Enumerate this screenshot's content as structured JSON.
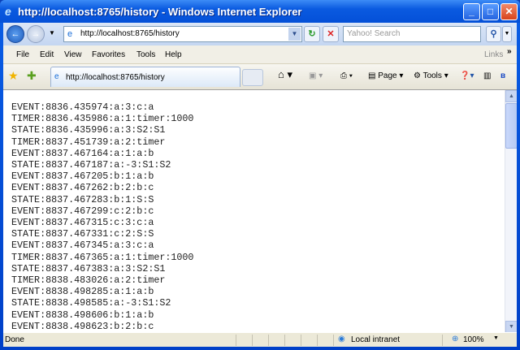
{
  "window": {
    "title": "http://localhost:8765/history - Windows Internet Explorer"
  },
  "addressbar": {
    "url": "http://localhost:8765/history",
    "search_placeholder": "Yahoo! Search"
  },
  "menu": [
    {
      "label": "File"
    },
    {
      "label": "Edit"
    },
    {
      "label": "View"
    },
    {
      "label": "Favorites"
    },
    {
      "label": "Tools"
    },
    {
      "label": "Help"
    }
  ],
  "links_label": "Links",
  "tab": {
    "label": "http://localhost:8765/history"
  },
  "toolbar": {
    "page_label": "Page",
    "tools_label": "Tools"
  },
  "log_lines": [
    "EVENT:8836.435974:a:3:c:a",
    "TIMER:8836.435986:a:1:timer:1000",
    "STATE:8836.435996:a:3:S2:S1",
    "TIMER:8837.451739:a:2:timer",
    "EVENT:8837.467164:a:1:a:b",
    "STATE:8837.467187:a:-3:S1:S2",
    "EVENT:8837.467205:b:1:a:b",
    "EVENT:8837.467262:b:2:b:c",
    "STATE:8837.467283:b:1:S:S",
    "EVENT:8837.467299:c:2:b:c",
    "EVENT:8837.467315:c:3:c:a",
    "STATE:8837.467331:c:2:S:S",
    "EVENT:8837.467345:a:3:c:a",
    "TIMER:8837.467365:a:1:timer:1000",
    "STATE:8837.467383:a:3:S2:S1",
    "TIMER:8838.483026:a:2:timer",
    "EVENT:8838.498285:a:1:a:b",
    "STATE:8838.498585:a:-3:S1:S2",
    "EVENT:8838.498606:b:1:a:b",
    "EVENT:8838.498623:b:2:b:c"
  ],
  "statusbar": {
    "status": "Done",
    "zone": "Local intranet",
    "zoom": "100%"
  }
}
